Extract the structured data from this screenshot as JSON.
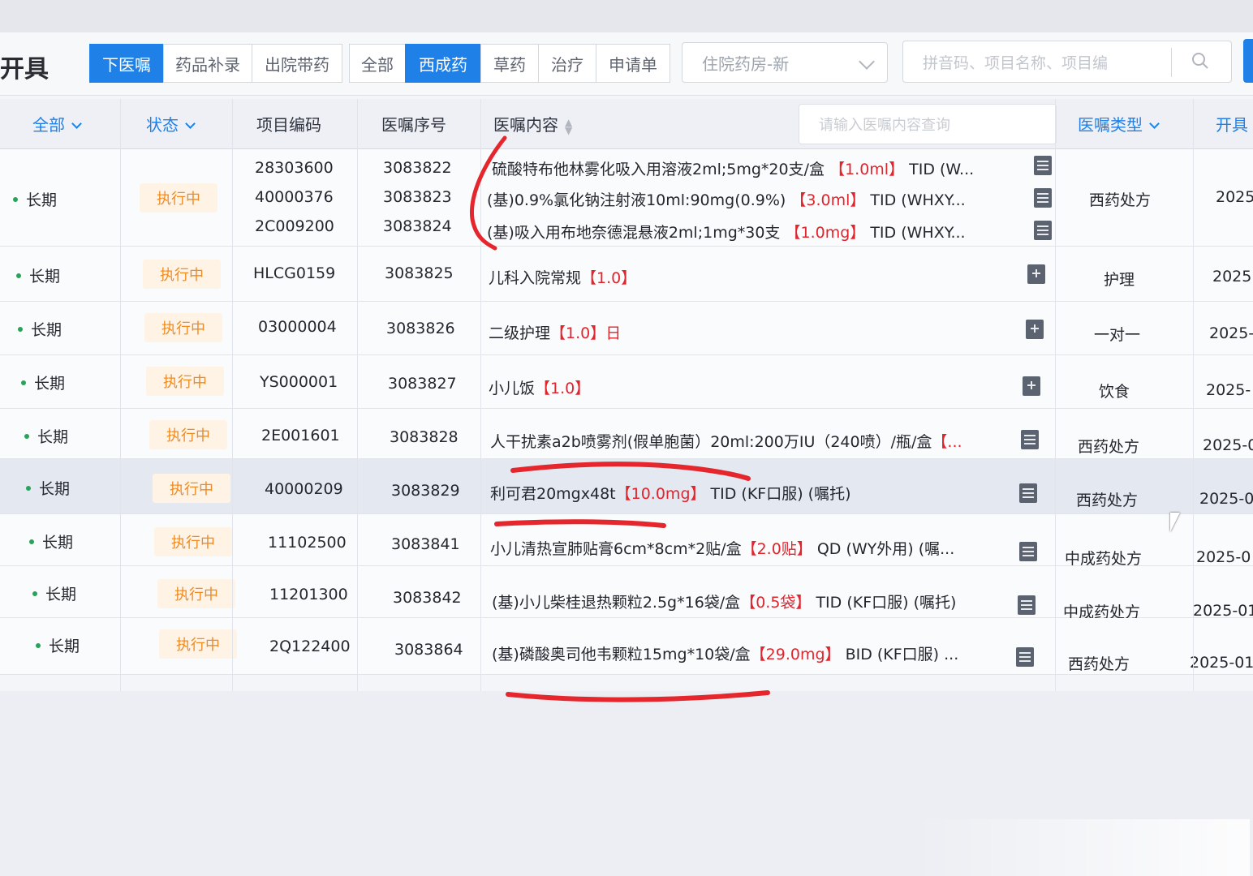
{
  "page": {
    "title": "开具"
  },
  "toolbar": {
    "tabs": [
      "下医嘱",
      "药品补录",
      "出院带药"
    ],
    "active_tab": "下医嘱",
    "filters": [
      "全部",
      "西成药",
      "草药",
      "治疗",
      "申请单"
    ],
    "active_filter": "西成药",
    "pharmacy_select": "住院药房-新",
    "search_placeholder": "拼音码、项目名称、项目编"
  },
  "table": {
    "headers": {
      "all": "全部",
      "status": "状态",
      "item_code": "项目编码",
      "order_no": "医嘱序号",
      "content": "医嘱内容",
      "content_filter_placeholder": "请输入医嘱内容查询",
      "order_type": "医嘱类型",
      "open": "开具"
    },
    "rows": [
      {
        "term": "长期",
        "status": "执行中",
        "codes": [
          "28303600",
          "40000376",
          "2C009200"
        ],
        "order_nos": [
          "3083822",
          "3083823",
          "3083824"
        ],
        "lines": [
          {
            "name": "硫酸特布他林雾化吸入用溶液2ml;5mg*20支/盒",
            "dose": "【1.0ml】",
            "freq": "TID (W..."
          },
          {
            "name": "(基)0.9%氯化钠注射液10ml:90mg(0.9%)",
            "dose": "【3.0ml】",
            "freq": "TID (WHXY..."
          },
          {
            "name": "(基)吸入用布地奈德混悬液2ml;1mg*30支",
            "dose": "【1.0mg】",
            "freq": "TID (WHXY..."
          }
        ],
        "type": "西药处方",
        "date": "2025"
      },
      {
        "term": "长期",
        "status": "执行中",
        "code": "HLCG0159",
        "order_no": "3083825",
        "name": "儿科入院常规",
        "dose": "【1.0】",
        "freq": "",
        "type": "护理",
        "date": "2025"
      },
      {
        "term": "长期",
        "status": "执行中",
        "code": "03000004",
        "order_no": "3083826",
        "name": "二级护理",
        "dose": "【1.0】日",
        "freq": "",
        "type": "一对一",
        "date": "2025-"
      },
      {
        "term": "长期",
        "status": "执行中",
        "code": "YS000001",
        "order_no": "3083827",
        "name": "小儿饭",
        "dose": "【1.0】",
        "freq": "",
        "type": "饮食",
        "date": "2025-"
      },
      {
        "term": "长期",
        "status": "执行中",
        "code": "2E001601",
        "order_no": "3083828",
        "name": "人干扰素a2b喷雾剂(假单胞菌）20ml:200万IU（240喷）/瓶/盒",
        "dose": "【...",
        "freq": "",
        "type": "西药处方",
        "date": "2025-0"
      },
      {
        "term": "长期",
        "status": "执行中",
        "code": "40000209",
        "order_no": "3083829",
        "name": "利可君20mgx48t",
        "dose": "【10.0mg】",
        "freq": "TID (KF口服)  (嘱托)",
        "type": "西药处方",
        "date": "2025-0"
      },
      {
        "term": "长期",
        "status": "执行中",
        "code": "11102500",
        "order_no": "3083841",
        "name": "小儿清热宣肺贴膏6cm*8cm*2贴/盒",
        "dose": "【2.0贴】",
        "freq": "QD (WY外用)  (嘱...",
        "type": "中成药处方",
        "date": "2025-0"
      },
      {
        "term": "长期",
        "status": "执行中",
        "code": "11201300",
        "order_no": "3083842",
        "name": "(基)小儿柴桂退热颗粒2.5g*16袋/盒",
        "dose": "【0.5袋】",
        "freq": "TID (KF口服)  (嘱托)",
        "type": "中成药处方",
        "date": "2025-01"
      },
      {
        "term": "长期",
        "status": "执行中",
        "code": "2Q122400",
        "order_no": "3083864",
        "name": "(基)磷酸奥司他韦颗粒15mg*10袋/盒",
        "dose": "【29.0mg】",
        "freq": "BID (KF口服)  ...",
        "type": "西药处方",
        "date": "2025-01"
      }
    ]
  },
  "colors": {
    "accent": "#1f80e8",
    "status": "#f08b22",
    "dose": "#e0252d",
    "pen": "#e5262d"
  }
}
